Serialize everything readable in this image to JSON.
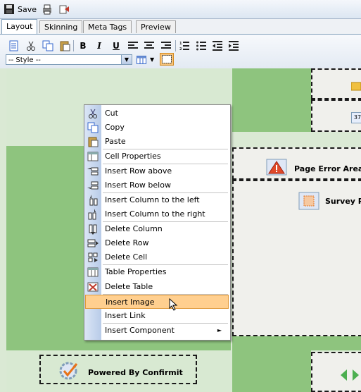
{
  "toolbar": {
    "save_label": "Save"
  },
  "tabs": [
    {
      "label": "Layout",
      "active": true
    },
    {
      "label": "Skinning",
      "active": false
    },
    {
      "label": "Meta Tags",
      "active": false
    },
    {
      "label": "Preview",
      "active": false
    }
  ],
  "format_toolbar": {
    "style_select_value": "-- Style --",
    "bold": "B",
    "italic": "I",
    "underline": "U"
  },
  "components": {
    "page_error_area": "Page Error Area",
    "survey": "Survey Pa",
    "powered_by": "Powered By Confirmit",
    "badge_number": "37"
  },
  "context_menu": {
    "items": [
      {
        "label": "Cut",
        "icon": "cut-icon"
      },
      {
        "label": "Copy",
        "icon": "copy-icon"
      },
      {
        "label": "Paste",
        "icon": "paste-icon"
      },
      {
        "label": "Cell Properties",
        "icon": "cell-properties-icon"
      },
      {
        "label": "Insert Row above",
        "icon": "insert-row-above-icon"
      },
      {
        "label": "Insert Row below",
        "icon": "insert-row-below-icon"
      },
      {
        "label": "Insert Column to the left",
        "icon": "insert-column-left-icon"
      },
      {
        "label": "Insert Column to the right",
        "icon": "insert-column-right-icon"
      },
      {
        "label": "Delete Column",
        "icon": "delete-column-icon"
      },
      {
        "label": "Delete Row",
        "icon": "delete-row-icon"
      },
      {
        "label": "Delete Cell",
        "icon": "delete-cell-icon"
      },
      {
        "label": "Table Properties",
        "icon": "table-properties-icon"
      },
      {
        "label": "Delete Table",
        "icon": "delete-table-icon"
      },
      {
        "label": "Insert Image",
        "highlighted": true
      },
      {
        "label": "Insert Link"
      },
      {
        "label": "Insert Component",
        "submenu": true
      }
    ]
  },
  "colors": {
    "cell_light": "#d8e9d2",
    "cell_dark": "#8ec47e",
    "menu_highlight": "#ffcf8f",
    "menu_gutter": "#b8cbe8"
  }
}
